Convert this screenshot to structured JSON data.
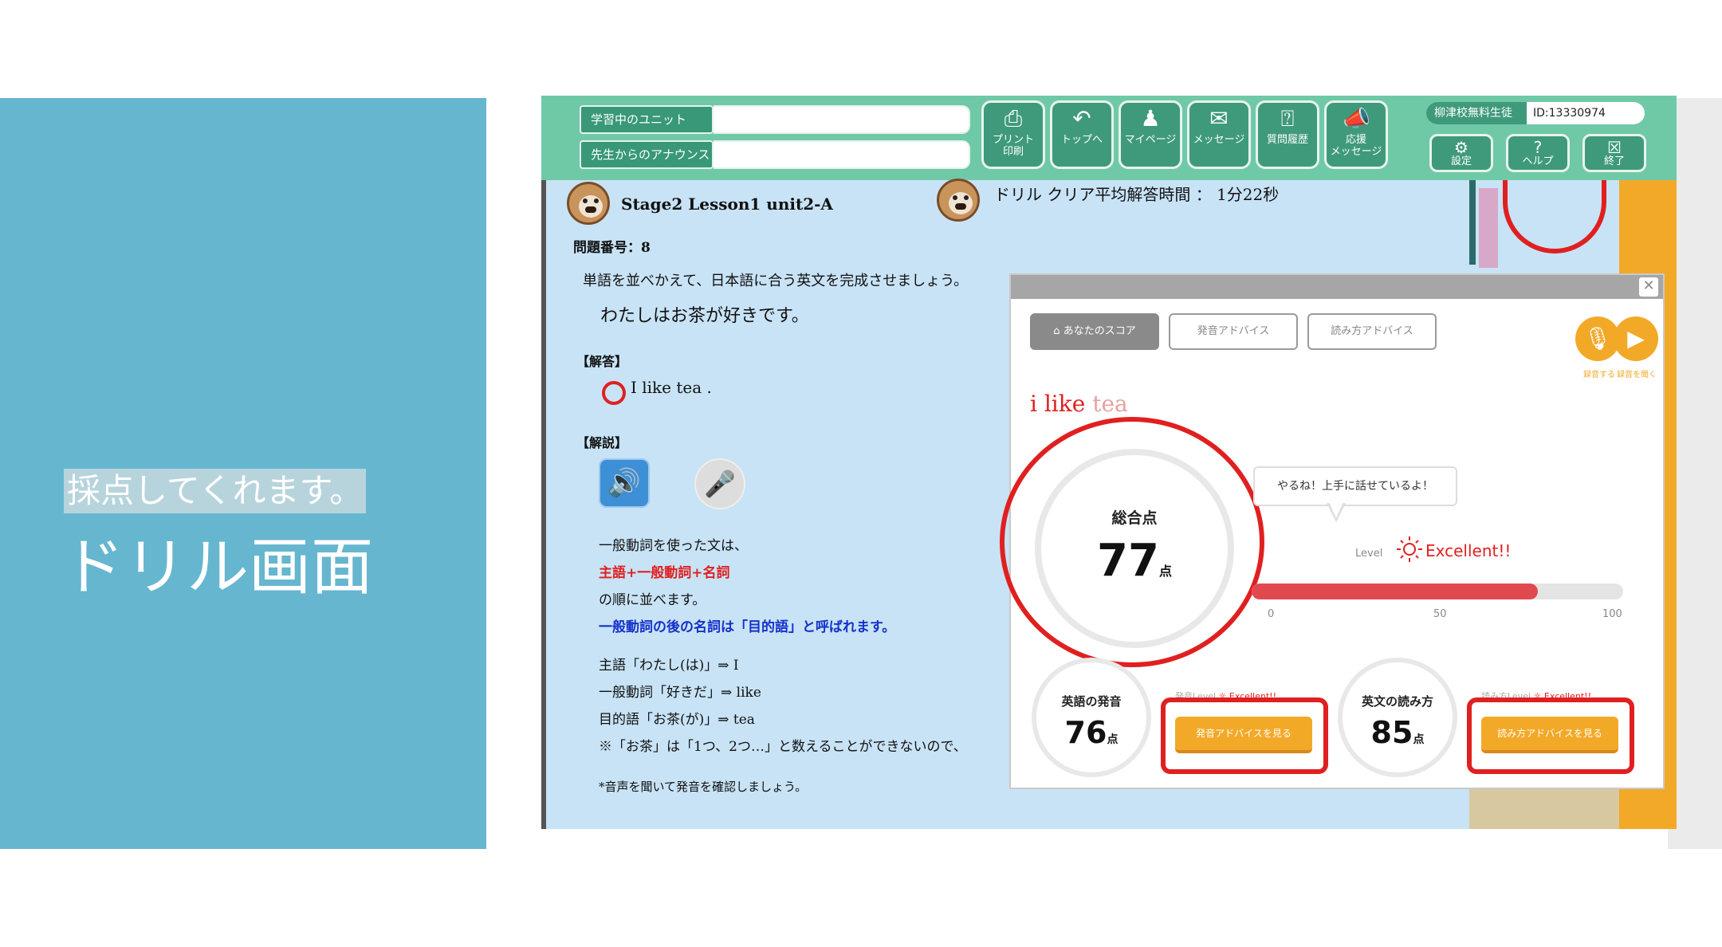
{
  "slide": {
    "subtitle": "採点してくれます。",
    "title": "ドリル画面"
  },
  "topbar": {
    "unit_label": "学習中のユニット",
    "unit_value": "",
    "announce_label": "先生からのアナウンス",
    "announce_value": "",
    "buttons": [
      {
        "icon": "printer-icon",
        "label1": "プリント",
        "label2": "印刷"
      },
      {
        "icon": "back-arrow-icon",
        "label1": "トップへ",
        "label2": ""
      },
      {
        "icon": "person-icon",
        "label1": "マイページ",
        "label2": ""
      },
      {
        "icon": "envelope-icon",
        "label1": "メッセージ",
        "label2": ""
      },
      {
        "icon": "question-history-icon",
        "label1": "質問履歴",
        "label2": ""
      },
      {
        "icon": "megaphone-icon",
        "label1": "応援",
        "label2": "メッセージ"
      }
    ],
    "user_name": "柳津校無料生徒",
    "user_id": "ID:13330974",
    "small_buttons": [
      {
        "icon": "gear-icon",
        "label": "設定"
      },
      {
        "icon": "question-icon",
        "label": "ヘルプ"
      },
      {
        "icon": "close-icon",
        "label": "終了"
      }
    ]
  },
  "lesson": {
    "title": "Stage2 Lesson1 unit2-A",
    "avg_time": "ドリル クリア平均解答時間 ： 1分22秒",
    "question_no": "問題番号：8",
    "instruction": "単語を並べかえて、日本語に合う英文を完成させましょう。",
    "jp_sentence": "わたしはお茶が好きです。",
    "answer_header": "【解答】",
    "answer": "I like tea .",
    "explain_header": "【解説】",
    "exp1": "一般動詞を使った文は、",
    "exp2": "主語+一般動詞+名詞",
    "exp3": "の順に並べます。",
    "exp4": "一般動詞の後の名詞は「目的語」と呼ばれます。",
    "exp5": "主語「わたし(は)」⇒ I",
    "exp6": "一般動詞「好きだ」⇒ like",
    "exp7": "目的語「お茶(が)」⇒ tea",
    "exp8": "※「お茶」は「1つ、2つ…」と数えることができないので、",
    "exp9": "*音声を聞いて発音を確認しましょう。"
  },
  "score_panel": {
    "tabs": [
      "あなたのスコア",
      "発音アドバイス",
      "読み方アドバイス"
    ],
    "record_label": "録音する",
    "play_label": "録音を聞く",
    "sentence_red": "i like ",
    "sentence_grey": "tea",
    "total_label": "総合点",
    "total_score": "77",
    "unit": "点",
    "bubble": "やるね！上手に話せているよ！",
    "level_label": "Level",
    "level_value": "Excellent!!",
    "bar_percent": 77,
    "ticks": [
      "0",
      "50",
      "100"
    ],
    "pron_label": "英語の発音",
    "pron_score": "76",
    "pron_level_label": "発音Level",
    "pron_level": "Excellent!!",
    "pron_btn": "発音アドバイスを見る",
    "read_label": "英文の読み方",
    "read_score": "85",
    "read_level_label": "読み方Level",
    "read_level": "Excellent!!",
    "read_btn": "読み方アドバイスを見る"
  },
  "colors": {
    "accent": "#66b6cf",
    "topbar": "#6fc9a7",
    "highlight": "#e02020",
    "orange": "#f3a928"
  }
}
